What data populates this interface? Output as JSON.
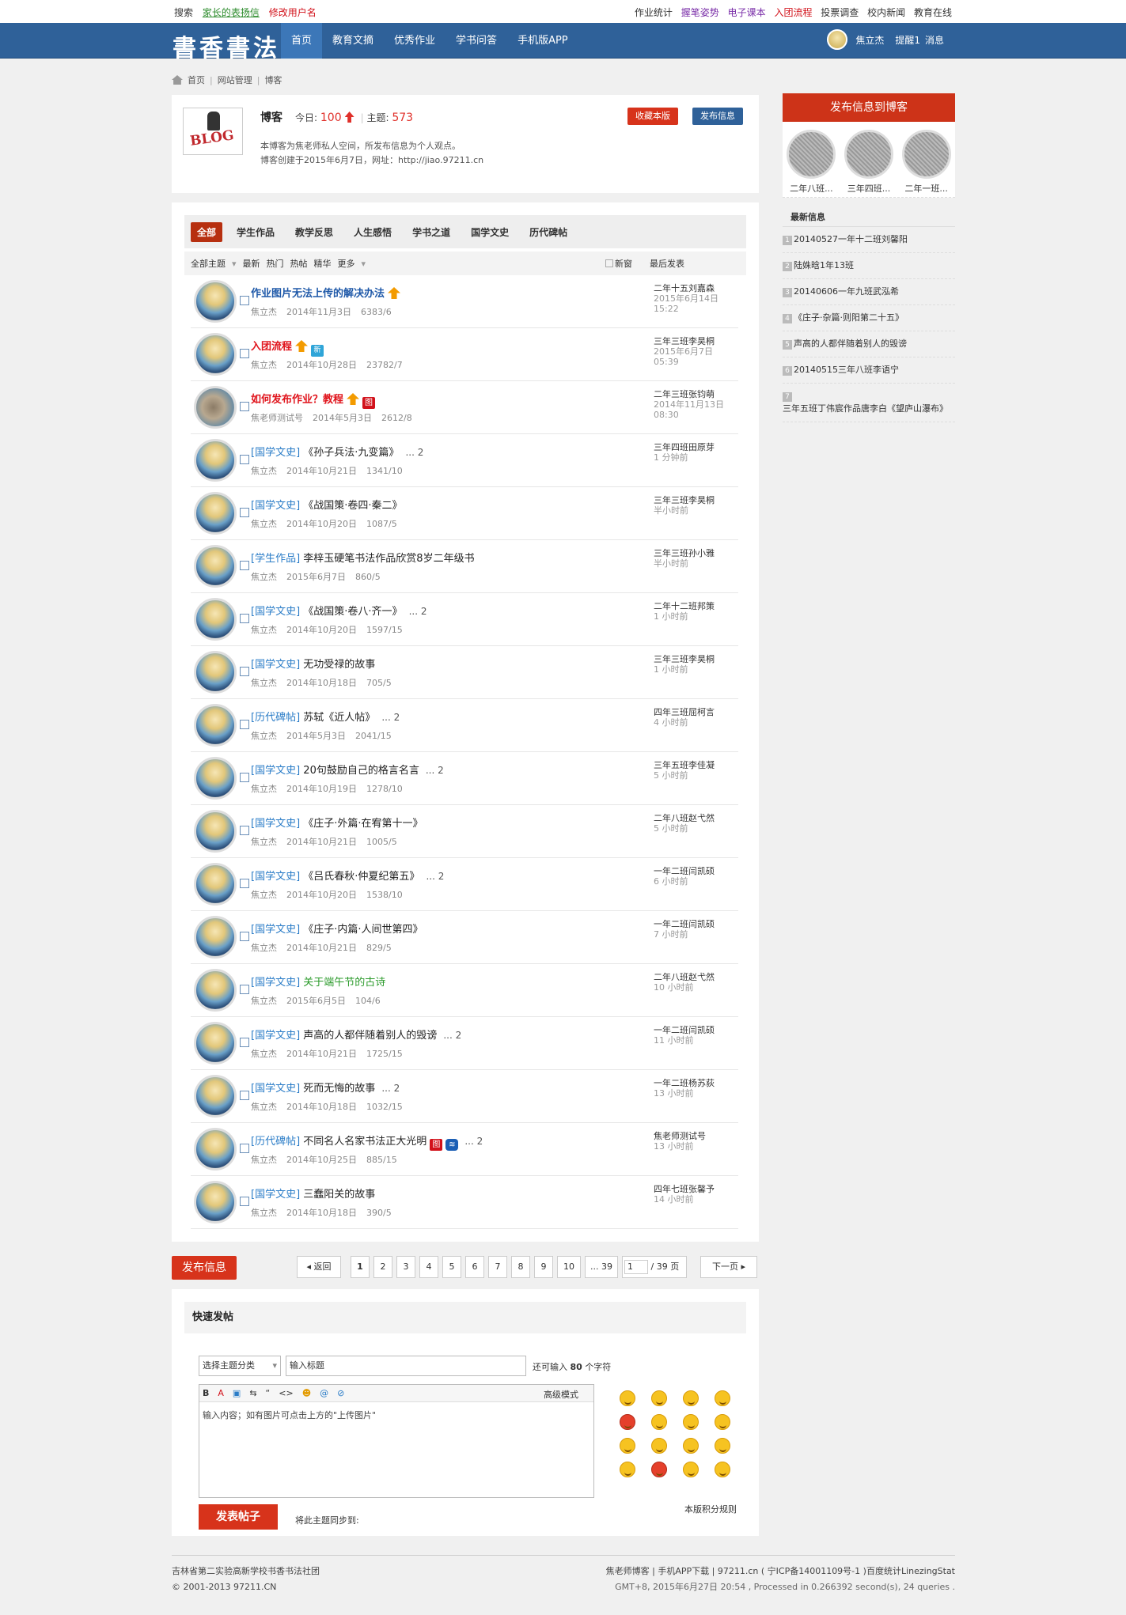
{
  "topbar": {
    "left": [
      "搜索",
      "家长的表扬信",
      "修改用户名"
    ],
    "right": [
      "作业统计",
      "握笔姿势",
      "电子课本",
      "入团流程",
      "投票调查",
      "校内新闻",
      "教育在线"
    ]
  },
  "nav": {
    "logo": "書香書法",
    "items": [
      "首页",
      "教育文摘",
      "优秀作业",
      "学书问答",
      "手机版APP"
    ],
    "user": "焦立杰",
    "remind": "提醒1",
    "msg": "消息"
  },
  "crumb": [
    "首页",
    "网站管理",
    "博客"
  ],
  "forum": {
    "logo_text": "BLOG",
    "name": "博客",
    "today_label": "今日:",
    "today": "100",
    "topics_label": "主题:",
    "topics": "573",
    "collect": "收藏本版",
    "post": "发布信息",
    "desc1": "本博客为焦老师私人空间，所发布信息为个人观点。",
    "desc2": "博客创建于2015年6月7日，网址：http://jiao.97211.cn"
  },
  "tabs": [
    "全部",
    "学生作品",
    "教学反思",
    "人生感悟",
    "学书之道",
    "国学文史",
    "历代碑帖"
  ],
  "filter": {
    "all": "全部主题",
    "items": [
      "最新",
      "热门",
      "热帖",
      "精华",
      "更多"
    ],
    "newwin": "新窗",
    "last": "最后发表"
  },
  "threads": [
    {
      "tag": "",
      "title": "作业图片无法上传的解决办法",
      "style": "blue",
      "icons": [
        "hot"
      ],
      "more": "",
      "author": "焦立杰",
      "date": "2014年11月3日",
      "stat": "6383/6",
      "lu": "二年十五刘嘉森",
      "lt1": "2015年6月14日",
      "lt2": "15:22",
      "alt": false
    },
    {
      "tag": "",
      "title": "入团流程",
      "style": "red",
      "icons": [
        "hot",
        "new"
      ],
      "more": "",
      "author": "焦立杰",
      "date": "2014年10月28日",
      "stat": "23782/7",
      "lu": "三年三班李昊桐",
      "lt1": "2015年6月7日",
      "lt2": "05:39",
      "alt": false
    },
    {
      "tag": "",
      "title": "如何发布作业？教程",
      "style": "red",
      "icons": [
        "hot",
        "pic"
      ],
      "more": "",
      "author": "焦老师测试号",
      "date": "2014年5月3日",
      "stat": "2612/8",
      "lu": "二年三班张钧萌",
      "lt1": "2014年11月13日",
      "lt2": "08:30",
      "alt": true
    },
    {
      "tag": "[国学文史]",
      "title": "《孙子兵法·九变篇》",
      "style": "",
      "icons": [],
      "more": "... 2",
      "author": "焦立杰",
      "date": "2014年10月21日",
      "stat": "1341/10",
      "lu": "三年四班田原芽",
      "lt1": "1 分钟前",
      "lt2": "",
      "alt": false
    },
    {
      "tag": "[国学文史]",
      "title": "《战国策·卷四·秦二》",
      "style": "",
      "icons": [],
      "more": "",
      "author": "焦立杰",
      "date": "2014年10月20日",
      "stat": "1087/5",
      "lu": "三年三班李昊桐",
      "lt1": "半小时前",
      "lt2": "",
      "alt": false
    },
    {
      "tag": "[学生作品]",
      "title": "李梓玉硬笔书法作品欣赏8岁二年级书",
      "style": "",
      "icons": [],
      "more": "",
      "author": "焦立杰",
      "date": "2015年6月7日",
      "stat": "860/5",
      "lu": "三年三班孙小雅",
      "lt1": "半小时前",
      "lt2": "",
      "alt": false
    },
    {
      "tag": "[国学文史]",
      "title": "《战国策·卷八·齐一》",
      "style": "",
      "icons": [],
      "more": "... 2",
      "author": "焦立杰",
      "date": "2014年10月20日",
      "stat": "1597/15",
      "lu": "二年十二班邦策",
      "lt1": "1 小时前",
      "lt2": "",
      "alt": false
    },
    {
      "tag": "[国学文史]",
      "title": "无功受禄的故事",
      "style": "",
      "icons": [],
      "more": "",
      "author": "焦立杰",
      "date": "2014年10月18日",
      "stat": "705/5",
      "lu": "三年三班李昊桐",
      "lt1": "1 小时前",
      "lt2": "",
      "alt": false
    },
    {
      "tag": "[历代碑帖]",
      "title": "苏轼《近人帖》",
      "style": "",
      "icons": [],
      "more": "... 2",
      "author": "焦立杰",
      "date": "2014年5月3日",
      "stat": "2041/15",
      "lu": "四年三班屈柯言",
      "lt1": "4 小时前",
      "lt2": "",
      "alt": false
    },
    {
      "tag": "[国学文史]",
      "title": "20句鼓励自己的格言名言",
      "style": "",
      "icons": [],
      "more": "... 2",
      "author": "焦立杰",
      "date": "2014年10月19日",
      "stat": "1278/10",
      "lu": "三年五班李佳凝",
      "lt1": "5 小时前",
      "lt2": "",
      "alt": false
    },
    {
      "tag": "[国学文史]",
      "title": "《庄子·外篇·在宥第十一》",
      "style": "",
      "icons": [],
      "more": "",
      "author": "焦立杰",
      "date": "2014年10月21日",
      "stat": "1005/5",
      "lu": "二年八班赵弋然",
      "lt1": "5 小时前",
      "lt2": "",
      "alt": false
    },
    {
      "tag": "[国学文史]",
      "title": "《吕氏春秋·仲夏纪第五》",
      "style": "",
      "icons": [],
      "more": "... 2",
      "author": "焦立杰",
      "date": "2014年10月20日",
      "stat": "1538/10",
      "lu": "一年二班闫凯硕",
      "lt1": "6 小时前",
      "lt2": "",
      "alt": false
    },
    {
      "tag": "[国学文史]",
      "title": "《庄子·内篇·人间世第四》",
      "style": "",
      "icons": [],
      "more": "",
      "author": "焦立杰",
      "date": "2014年10月21日",
      "stat": "829/5",
      "lu": "一年二班闫凯硕",
      "lt1": "7 小时前",
      "lt2": "",
      "alt": false
    },
    {
      "tag": "[国学文史]",
      "title": "关于端午节的古诗",
      "style": "green",
      "icons": [],
      "more": "",
      "author": "焦立杰",
      "date": "2015年6月5日",
      "stat": "104/6",
      "lu": "二年八班赵弋然",
      "lt1": "10 小时前",
      "lt2": "",
      "alt": false
    },
    {
      "tag": "[国学文史]",
      "title": "声高的人都伴随着别人的毁谤",
      "style": "",
      "icons": [],
      "more": "... 2",
      "author": "焦立杰",
      "date": "2014年10月21日",
      "stat": "1725/15",
      "lu": "一年二班闫凯硕",
      "lt1": "11 小时前",
      "lt2": "",
      "alt": false
    },
    {
      "tag": "[国学文史]",
      "title": "死而无悔的故事",
      "style": "",
      "icons": [],
      "more": "... 2",
      "author": "焦立杰",
      "date": "2014年10月18日",
      "stat": "1032/15",
      "lu": "一年二班杨苏荻",
      "lt1": "13 小时前",
      "lt2": "",
      "alt": false
    },
    {
      "tag": "[历代碑帖]",
      "title": "不同名人名家书法正大光明",
      "style": "",
      "icons": [
        "pic",
        "wifi"
      ],
      "more": "... 2",
      "author": "焦立杰",
      "date": "2014年10月25日",
      "stat": "885/15",
      "lu": "焦老师测试号",
      "lt1": "13 小时前",
      "lt2": "",
      "alt": false
    },
    {
      "tag": "[国学文史]",
      "title": "三蠢阳关的故事",
      "style": "",
      "icons": [],
      "more": "",
      "author": "焦立杰",
      "date": "2014年10月18日",
      "stat": "390/5",
      "lu": "四年七班张馨予",
      "lt1": "14 小时前",
      "lt2": "",
      "alt": false
    }
  ],
  "pager": {
    "post": "发布信息",
    "back": "返回",
    "pages": [
      "1",
      "2",
      "3",
      "4",
      "5",
      "6",
      "7",
      "8",
      "9",
      "10",
      "... 39"
    ],
    "input": "1",
    "total": "/ 39 页",
    "next": "下一页"
  },
  "quickpost": {
    "title": "快速发帖",
    "select": "选择主题分类",
    "subject_ph": "输入标题",
    "can_input": "还可输入",
    "count": "80",
    "chars": "个字符",
    "advanced": "高级模式",
    "content_ph": "输入内容；如有图片可点击上方的\"上传图片\"",
    "submit": "发表帖子",
    "sync": "将此主题同步到:",
    "rule": "本版积分规则",
    "toolbar": [
      "B",
      "A",
      "▣",
      "⇆",
      "“",
      "<>",
      "☻",
      "@",
      "⊘"
    ]
  },
  "side": {
    "button": "发布信息到博客",
    "thumbs": [
      "二年八班...",
      "三年四班...",
      "二年一班..."
    ],
    "latest_title": "最新信息",
    "latest": [
      "20140527一年十二班刘馨阳",
      "陆姝晗1年13班",
      "20140606一年九班武泓希",
      "《庄子·杂篇·则阳第二十五》",
      "声高的人都伴随着别人的毁谤",
      "20140515三年八班李语宁",
      "三年五班丁伟宸作品唐李白《望庐山瀑布》"
    ]
  },
  "footer": {
    "l1": "吉林省第二实验高新学校书香书法社团",
    "l2": "© 2001-2013 97211.CN",
    "r1": "焦老师博客 | 手机APP下载 | 97211.cn ( 宁ICP备14001109号-1 )百度统计LinezingStat",
    "r2": "GMT+8, 2015年6月27日 20:54 , Processed in 0.266392 second(s), 24 queries ."
  },
  "colors": {
    "nav": "#2f6199",
    "accent": "#d7331b",
    "link": "#2a7cc7"
  }
}
